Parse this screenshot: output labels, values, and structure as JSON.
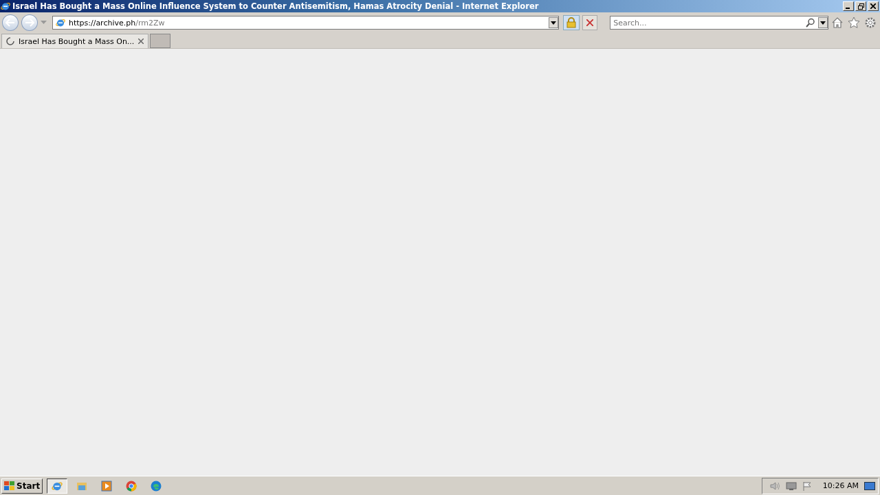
{
  "window": {
    "title": "Israel Has Bought a Mass Online Influence System to Counter Antisemitism, Hamas Atrocity Denial - Internet Explorer"
  },
  "address_bar": {
    "host": "https://archive.ph",
    "path": "/rm2Zw"
  },
  "search": {
    "placeholder": "Search..."
  },
  "tabs": [
    {
      "label": "Israel Has Bought a Mass On...",
      "selected": true,
      "loading": true
    }
  ],
  "taskbar": {
    "start": "Start",
    "apps": [
      {
        "kind": "ie",
        "selected": true
      },
      {
        "kind": "folder",
        "selected": false
      },
      {
        "kind": "media",
        "selected": false
      },
      {
        "kind": "chrome",
        "selected": false
      },
      {
        "kind": "edge",
        "selected": false
      }
    ],
    "clock": "10:26 AM"
  }
}
